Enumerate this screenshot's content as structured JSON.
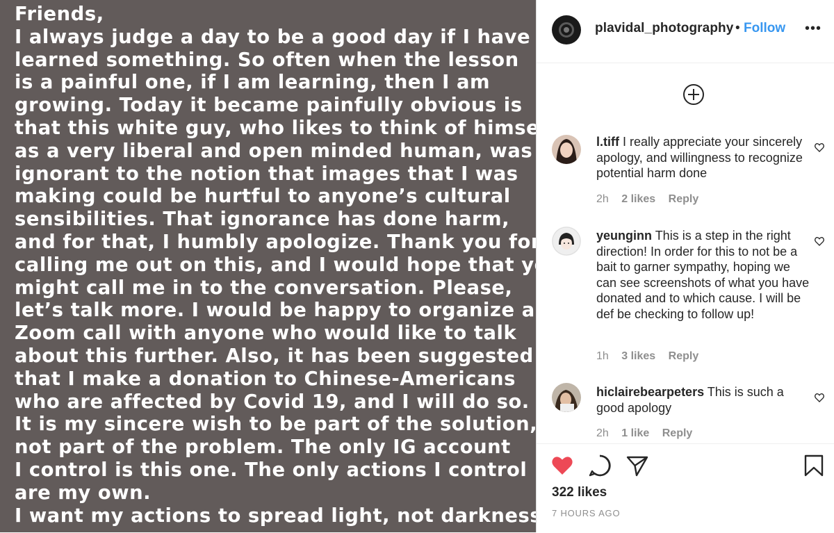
{
  "post": {
    "lines": [
      "Friends,",
      "I always judge a day to be a good day if I have",
      "learned something. So often when the lesson",
      "is a painful one, if I am learning, then I am",
      "growing. Today it became painfully obvious is",
      "that this white guy, who likes to think of himself",
      "as a very liberal and open minded human, was",
      "ignorant to the notion that images that I was",
      "making could be hurtful to anyone’s cultural",
      "sensibilities. That ignorance has done harm,",
      "and for that, I humbly apologize. Thank you for",
      "calling me out on this, and I would hope that you",
      "might call me in to the conversation. Please,",
      "let’s talk more. I would be happy to organize a",
      "Zoom call with anyone who would like to talk",
      "about this further. Also, it has been suggested",
      "that I make a donation to Chinese-Americans",
      "who are affected by Covid 19, and I will do so.",
      "It is my sincere wish to be part of the solution,",
      "not part of the problem. The only IG account",
      "I control is this one. The only actions I control",
      "are my own.",
      "I want my actions to spread light, not darkness."
    ]
  },
  "header": {
    "username": "plavidal_photography",
    "separator": "•",
    "follow_label": "Follow",
    "more_label": "•••"
  },
  "comments": [
    {
      "user": "l.tiff",
      "text": "I really appreciate your sincerely apology, and willingness to recognize potential harm done",
      "time": "2h",
      "likes": "2 likes",
      "reply": "Reply"
    },
    {
      "user": "yeunginn",
      "text": "This is a step in the right direction! In order for this to not be a bait to garner sympathy, hoping we can see screenshots of what you have donated and to which cause. I will be def be checking to follow up!",
      "time": "1h",
      "likes": "3 likes",
      "reply": "Reply"
    },
    {
      "user": "hiclairebearpeters",
      "text": "This is such a good apology",
      "time": "2h",
      "likes": "1 like",
      "reply": "Reply"
    }
  ],
  "footer": {
    "likes": "322 likes",
    "time": "7 HOURS AGO"
  },
  "colors": {
    "image_bg": "#625b5a",
    "follow": "#3897f0",
    "heart": "#ed4956",
    "text": "#262626",
    "muted": "#8e8e8e"
  },
  "icons": [
    "plus-circle-icon",
    "heart-outline-icon",
    "heart-filled-icon",
    "comment-icon",
    "share-icon",
    "bookmark-icon",
    "more-icon"
  ]
}
